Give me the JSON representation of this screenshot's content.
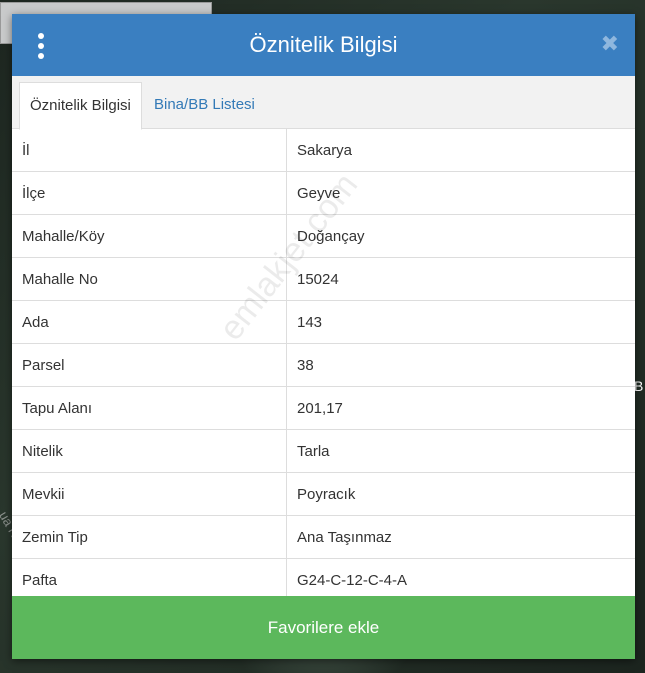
{
  "background": {
    "edge_text": "B",
    "road_text": "ua Ne"
  },
  "modal": {
    "title": "Öznitelik Bilgisi",
    "close_symbol": "✖",
    "menu_icon": "vertical-dots-icon"
  },
  "tabs": [
    {
      "label": "Öznitelik Bilgisi",
      "active": true
    },
    {
      "label": "Bina/BB Listesi",
      "active": false
    }
  ],
  "rows": [
    {
      "key": "İl",
      "value": "Sakarya"
    },
    {
      "key": "İlçe",
      "value": "Geyve"
    },
    {
      "key": "Mahalle/Köy",
      "value": "Doğançay"
    },
    {
      "key": "Mahalle No",
      "value": "15024"
    },
    {
      "key": "Ada",
      "value": "143"
    },
    {
      "key": "Parsel",
      "value": "38"
    },
    {
      "key": "Tapu Alanı",
      "value": "201,17"
    },
    {
      "key": "Nitelik",
      "value": "Tarla"
    },
    {
      "key": "Mevkii",
      "value": "Poyracık"
    },
    {
      "key": "Zemin Tip",
      "value": "Ana Taşınmaz"
    },
    {
      "key": "Pafta",
      "value": "G24-C-12-C-4-A"
    }
  ],
  "footer": {
    "button_label": "Favorilere ekle"
  },
  "watermark": "emlakjet.com",
  "colors": {
    "header": "#3a7fc1",
    "tab_link": "#337ab7",
    "button": "#5cb85c"
  }
}
